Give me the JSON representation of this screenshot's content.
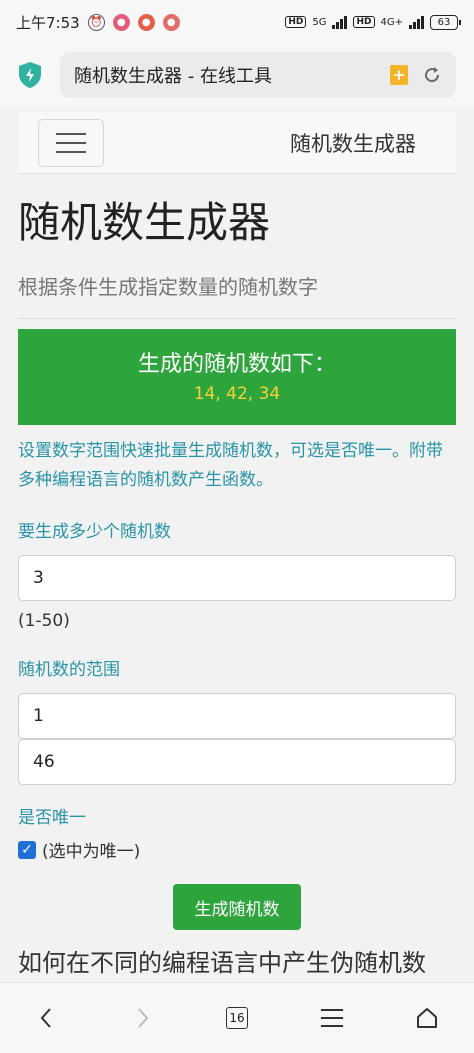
{
  "status_bar": {
    "time": "上午7:53",
    "network_5g": "5G",
    "network_4g": "4G+",
    "battery": "63"
  },
  "browser": {
    "page_title": "随机数生成器 - 在线工具",
    "tab_count": "16"
  },
  "navbar": {
    "brand": "随机数生成器"
  },
  "page": {
    "heading": "随机数生成器",
    "lead": "根据条件生成指定数量的随机数字",
    "result_title": "生成的随机数如下：",
    "result_values": "14, 42, 34",
    "description": "设置数字范围快速批量生成随机数，可选是否唯一。附带多种编程语言的随机数产生函数。",
    "count_label": "要生成多少个随机数",
    "count_value": "3",
    "count_help": "(1-50)",
    "range_label": "随机数的范围",
    "range_min": "1",
    "range_max": "46",
    "unique_label": "是否唯一",
    "unique_checkbox_text": "(选中为唯一)",
    "unique_checked": true,
    "generate_button": "生成随机数",
    "section_heading": "如何在不同的编程语言中产生伪随机数"
  },
  "colors": {
    "accent_green": "#2ea53c",
    "result_value": "#f7d13b",
    "label_teal": "#2894a8",
    "checkbox_blue": "#1f6fd6"
  }
}
